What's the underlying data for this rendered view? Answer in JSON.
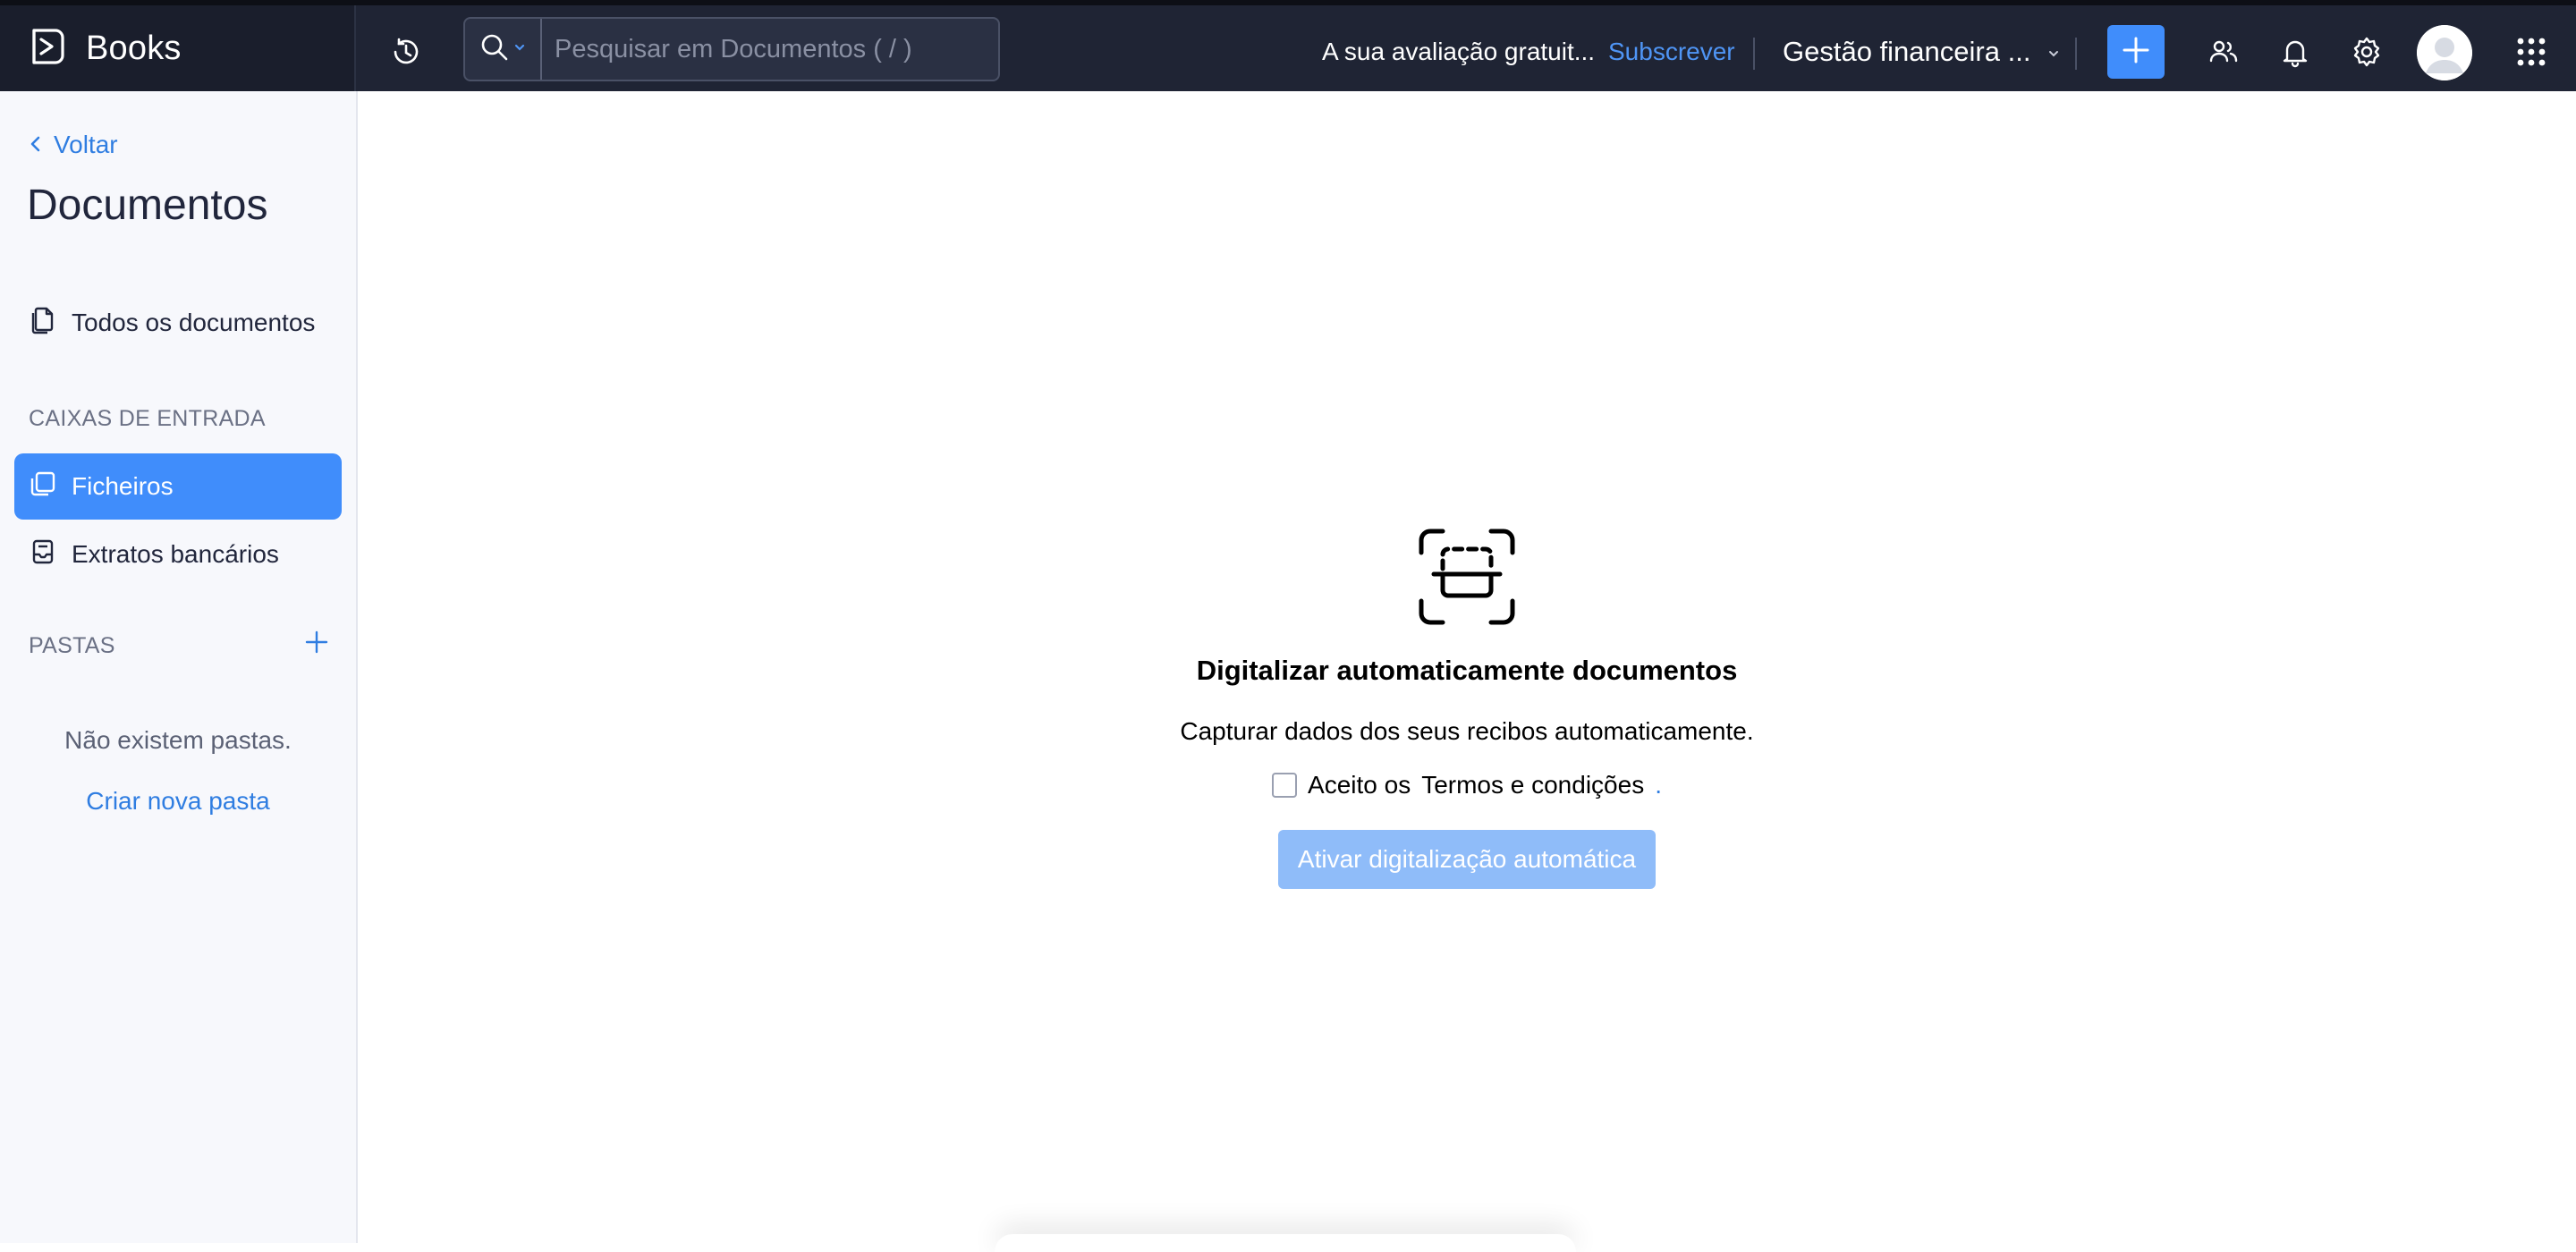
{
  "app": {
    "name": "Books"
  },
  "topbar": {
    "search_placeholder": "Pesquisar em Documentos ( / )",
    "trial_text": "A sua avaliação gratuit...",
    "subscribe_label": "Subscrever",
    "org_name": "Gestão financeira ...",
    "accent_color": "#408dfb",
    "icons": [
      "history-icon",
      "search-icon",
      "chevron-down-icon",
      "plus-icon",
      "users-icon",
      "bell-icon",
      "gear-icon",
      "avatar",
      "apps-grid-icon"
    ]
  },
  "sidebar": {
    "back_label": "Voltar",
    "title": "Documentos",
    "all_documents_label": "Todos os documentos",
    "inboxes_heading": "CAIXAS DE ENTRADA",
    "inboxes": [
      {
        "label": "Ficheiros",
        "active": true
      },
      {
        "label": "Extratos bancários",
        "active": false
      }
    ],
    "folders_heading": "PASTAS",
    "no_folders_text": "Não existem pastas.",
    "create_folder_label": "Criar nova pasta"
  },
  "main": {
    "empty_state": {
      "title": "Digitalizar automaticamente documentos",
      "description": "Capturar dados dos seus recibos automaticamente.",
      "terms_prefix": "Aceito os",
      "terms_link": "Termos e condições",
      "terms_suffix": ".",
      "terms_checked": false,
      "button_label": "Ativar digitalização automática"
    }
  }
}
